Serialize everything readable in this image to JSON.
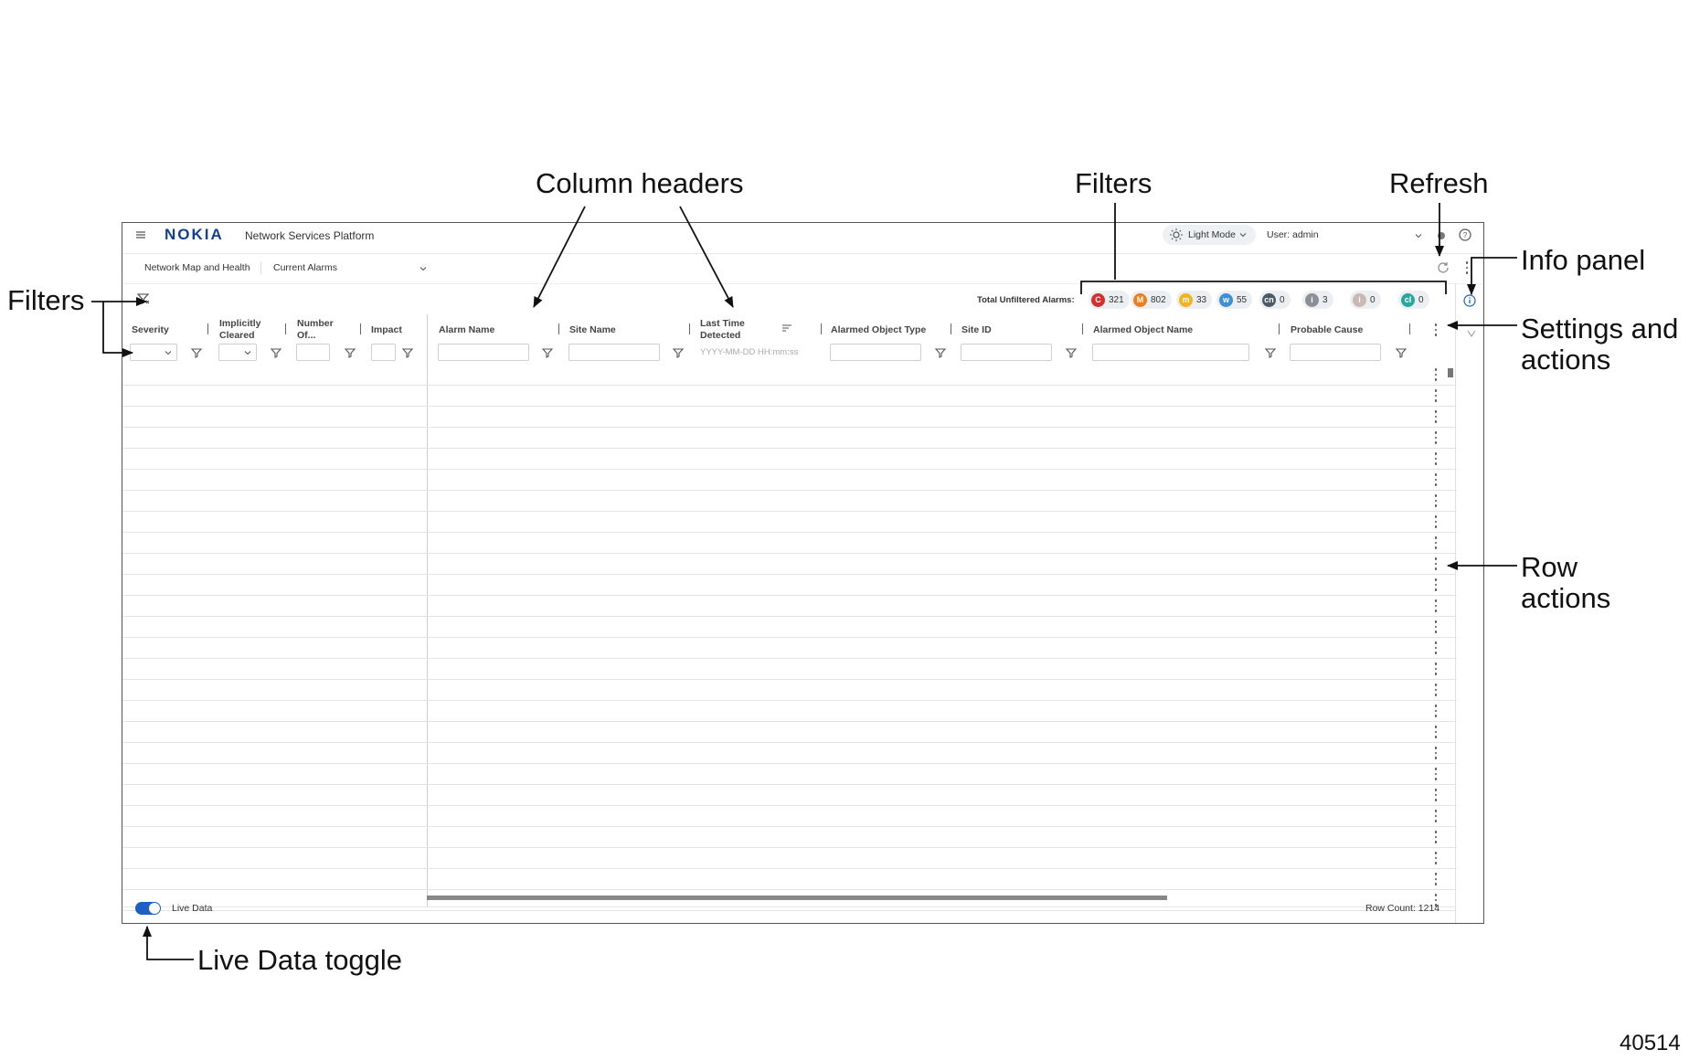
{
  "annotations": {
    "column_headers": "Column headers",
    "filters_top": "Filters",
    "refresh": "Refresh",
    "info_panel": "Info panel",
    "filters_left": "Filters",
    "settings_line1": "Settings and",
    "settings_line2": "actions",
    "row_actions_line1": "Row",
    "row_actions_line2": "actions",
    "live_data_toggle": "Live Data toggle",
    "figure_number": "40514"
  },
  "app": {
    "brand": "NOKIA",
    "title": "Network Services Platform",
    "theme_label": "Light Mode",
    "user_label": "User: admin"
  },
  "nav": {
    "breadcrumb": "Network Map and Health",
    "view": "Current Alarms"
  },
  "summary": {
    "label": "Total Unfiltered Alarms:",
    "counts": [
      {
        "letter": "C",
        "count": "321",
        "color": "#d32f2f"
      },
      {
        "letter": "M",
        "count": "802",
        "color": "#ef7d1a"
      },
      {
        "letter": "m",
        "count": "33",
        "color": "#f3b31b"
      },
      {
        "letter": "w",
        "count": "55",
        "color": "#3d8fd6"
      },
      {
        "letter": "cn",
        "count": "0",
        "color": "#4b5a66"
      },
      {
        "letter": "i",
        "count": "3",
        "color": "#8a9096"
      },
      {
        "letter": "i",
        "count": "0",
        "color": "#c9b8b3"
      },
      {
        "letter": "cl",
        "count": "0",
        "color": "#27a89c"
      }
    ]
  },
  "columns": {
    "severity": "Severity",
    "implicitly_1": "Implicitly",
    "implicitly_2": "Cleared",
    "number_1": "Number",
    "number_2": "Of...",
    "impact": "Impact",
    "alarm_name": "Alarm Name",
    "site_name": "Site Name",
    "last_time_1": "Last Time",
    "last_time_2": "Detected",
    "object_type": "Alarmed Object Type",
    "site_id": "Site ID",
    "object_name": "Alarmed Object Name",
    "probable_cause": "Probable Cause"
  },
  "filters": {
    "date_placeholder": "YYYY-MM-DD HH:mm:ss"
  },
  "footer": {
    "live_data_label": "Live Data",
    "row_count": "Row Count: 1214"
  },
  "colors": {
    "accent": "#1f5fc4",
    "brand": "#124191"
  }
}
